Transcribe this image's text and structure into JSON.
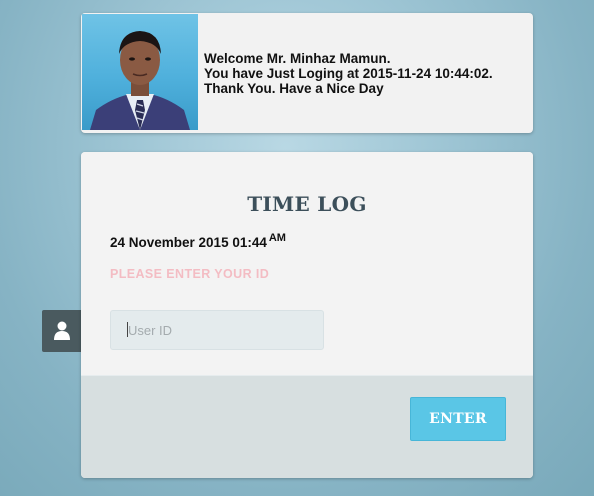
{
  "welcome": {
    "line1": "Welcome Mr. Minhaz Mamun.",
    "line2": "You have Just Loging at 2015-11-24 10:44:02.",
    "line3": "Thank You. Have a Nice Day"
  },
  "timelog": {
    "title": "TIME LOG",
    "date": "24 November 2015 01:44",
    "ampm": "AM",
    "prompt": "PLEASE ENTER YOUR ID",
    "userid_placeholder": "User ID",
    "userid_value": "",
    "enter_label": "ENTER"
  },
  "colors": {
    "enter_button": "#5ac6e6",
    "prompt_text": "#f3bcc3",
    "icon_box": "#4a5a5f"
  },
  "icons": {
    "side_icon": "user-icon"
  }
}
